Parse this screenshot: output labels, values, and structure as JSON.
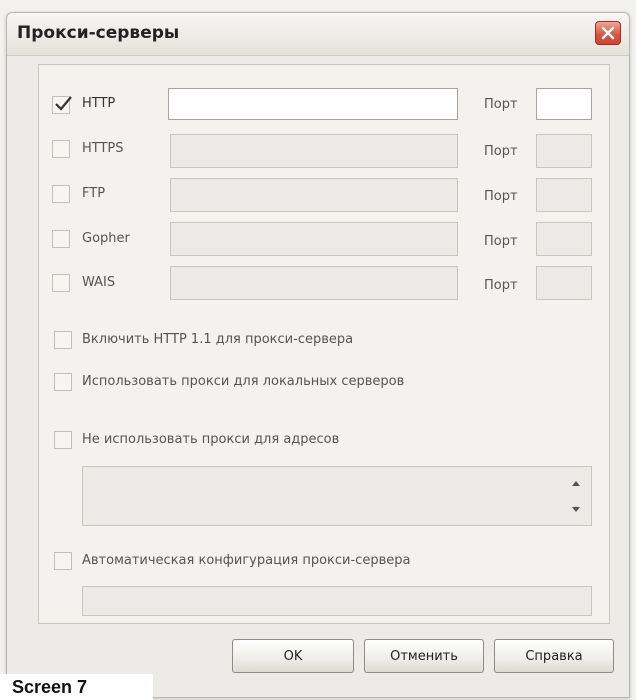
{
  "window": {
    "title": "Прокси-серверы"
  },
  "protocols": [
    {
      "name": "HTTP",
      "checked": true,
      "port_label": "Порт"
    },
    {
      "name": "HTTPS",
      "checked": false,
      "port_label": "Порт"
    },
    {
      "name": "FTP",
      "checked": false,
      "port_label": "Порт"
    },
    {
      "name": "Gopher",
      "checked": false,
      "port_label": "Порт"
    },
    {
      "name": "WAIS",
      "checked": false,
      "port_label": "Порт"
    }
  ],
  "options": {
    "http11": "Включить HTTP 1.1 для прокси-сервера",
    "local": "Использовать прокси для локальных серверов",
    "exclude": "Не использовать прокси для адресов",
    "auto": "Автоматическая конфигурация прокси-сервера"
  },
  "buttons": {
    "ok": "OK",
    "cancel": "Отменить",
    "help": "Справка"
  },
  "caption": "Screen 7",
  "icons": {
    "close": "close-icon",
    "check": "checkmark-icon",
    "scroll_up": "chevron-up-icon",
    "scroll_down": "chevron-down-icon"
  },
  "colors": {
    "close_button": "#d65a43",
    "dialog_bg": "#ecebe7"
  }
}
